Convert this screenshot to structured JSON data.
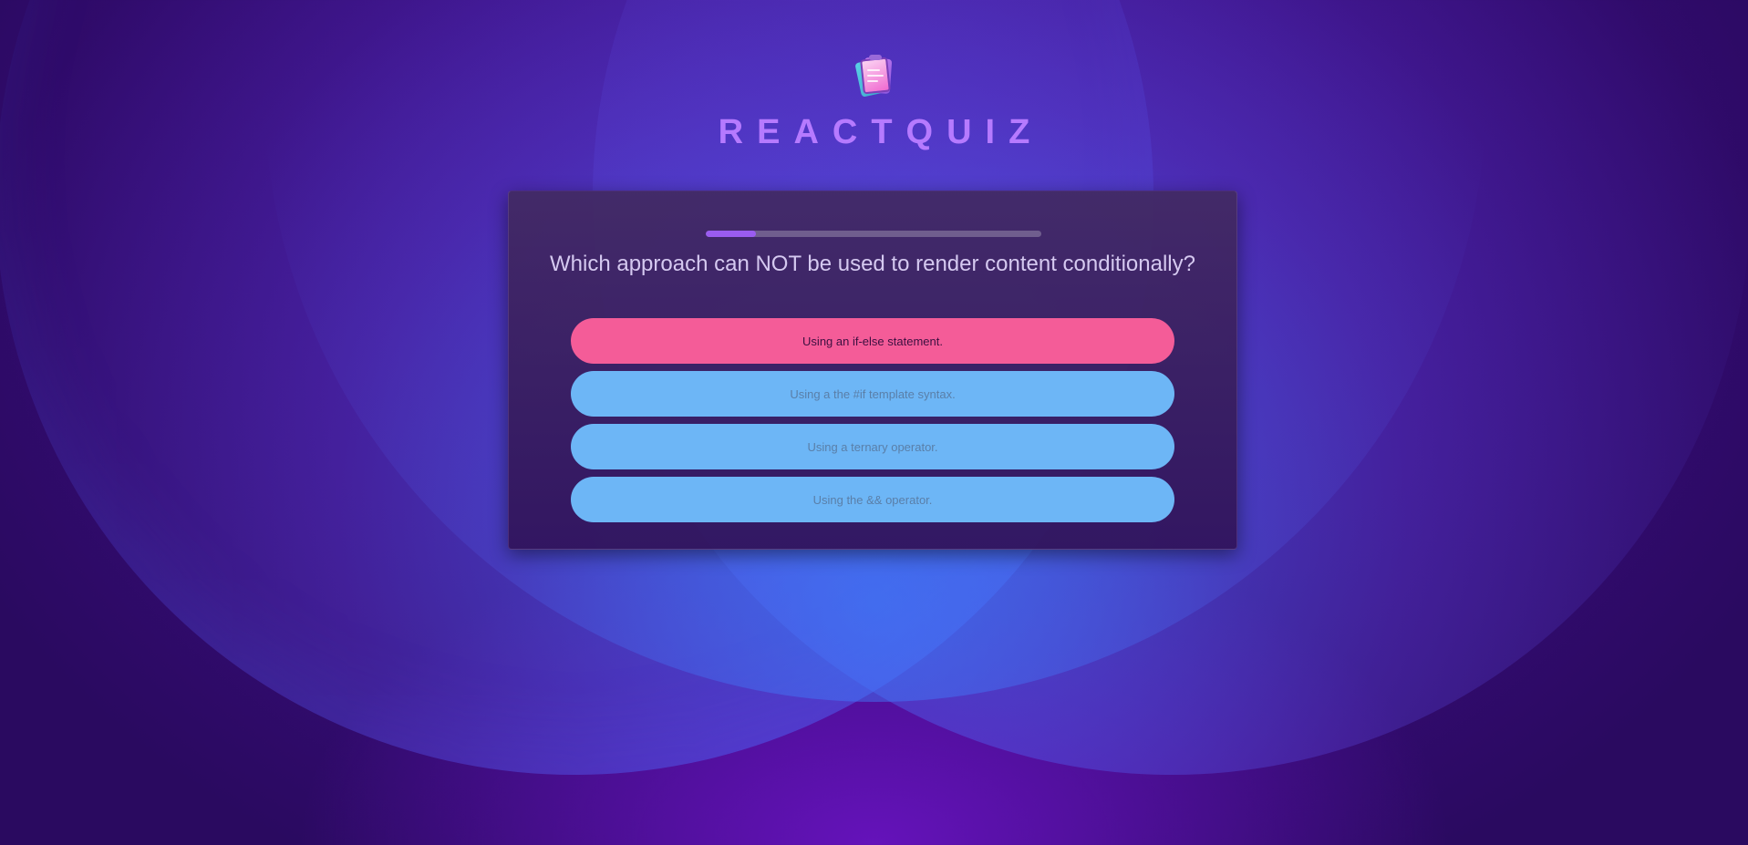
{
  "app": {
    "title": "REACTQUIZ",
    "logo_icon": "quiz-cards-icon"
  },
  "progress": {
    "fraction": 0.15
  },
  "question": {
    "text": "Which approach can NOT be used to render content conditionally?",
    "options": [
      {
        "label": "Using an if-else statement.",
        "state": "selected"
      },
      {
        "label": "Using a the #if template syntax.",
        "state": "normal"
      },
      {
        "label": "Using a ternary operator.",
        "state": "normal"
      },
      {
        "label": "Using the && operator.",
        "state": "normal"
      }
    ]
  },
  "colors": {
    "accent": "#b67aff",
    "selected_option": "#f45c98",
    "option": "#6db6f6",
    "progress_fill": "#9a5cf0"
  }
}
